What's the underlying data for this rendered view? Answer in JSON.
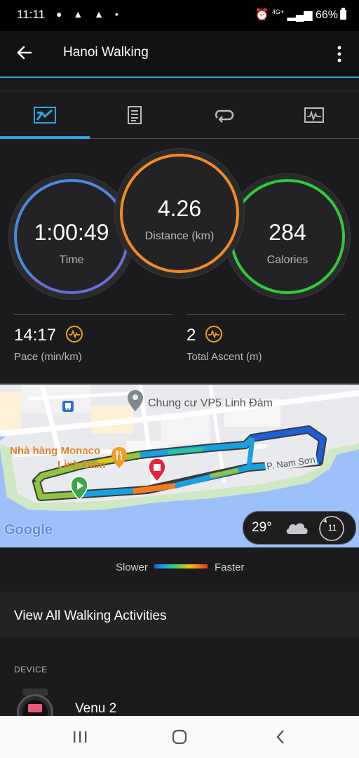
{
  "status_bar": {
    "time": "11:11",
    "network": "4G+",
    "battery": "66%"
  },
  "app_bar": {
    "title": "Hanoi Walking"
  },
  "tabs": [
    {
      "name": "stats"
    },
    {
      "name": "details"
    },
    {
      "name": "laps"
    },
    {
      "name": "charts"
    }
  ],
  "stats": {
    "time": {
      "value": "1:00:49",
      "label": "Time"
    },
    "distance": {
      "value": "4.26",
      "label": "Distance (km)"
    },
    "calories": {
      "value": "284",
      "label": "Calories"
    },
    "pace": {
      "value": "14:17",
      "label": "Pace (min/km)"
    },
    "ascent": {
      "value": "2",
      "label": "Total Ascent (m)"
    }
  },
  "map": {
    "poi_1": "Chung cư VP5 Linh Đàm",
    "poi_2_line1": "Nhà hàng Monaco",
    "poi_2_line2": "Linh Đàm",
    "street": "P. Nam Sơn",
    "google": "Google",
    "temperature": "29°",
    "wind": "11"
  },
  "legend": {
    "slower": "Slower",
    "faster": "Faster"
  },
  "view_all": "View All Walking Activities",
  "device": {
    "header": "DEVICE",
    "name": "Venu 2"
  },
  "colors": {
    "accent_blue": "#2aa7e0",
    "time_ring": "#6a6ed8",
    "distance_ring": "#f08a24",
    "calories_ring": "#2fcc3a"
  }
}
